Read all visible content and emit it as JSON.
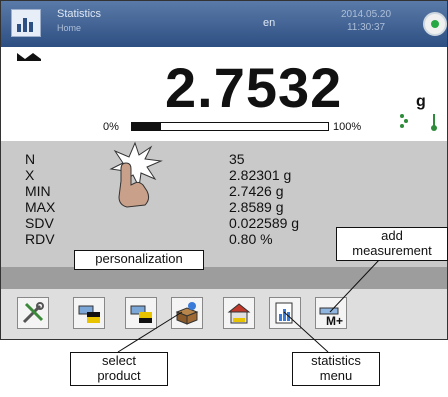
{
  "header": {
    "app_title": "Statistics",
    "app_subtitle": "Home",
    "language": "en",
    "date": "2014.05.20",
    "time": "11:30:37",
    "logo_icon": "statistics-chart-icon",
    "status_icon": "level-indicator-icon"
  },
  "weighing": {
    "reading": "2.7532",
    "unit": "g",
    "range_min_label": "0%",
    "range_max_label": "100%",
    "bar_fill_fraction": 0.15
  },
  "stats": {
    "rows": [
      {
        "label": "N",
        "value": "35"
      },
      {
        "label": "X",
        "value": "2.82301 g"
      },
      {
        "label": "MIN",
        "value": "2.7426 g"
      },
      {
        "label": "MAX",
        "value": "2.8589 g"
      },
      {
        "label": "SDV",
        "value": "0.022589 g"
      },
      {
        "label": "RDV",
        "value": "0.80 %"
      }
    ]
  },
  "toolbar": {
    "buttons": [
      {
        "icon": "settings-tools-icon"
      },
      {
        "icon": "printer-header-icon"
      },
      {
        "icon": "printer-footer-icon"
      },
      {
        "icon": "product-box-icon"
      },
      {
        "icon": "home-warehouse-icon"
      },
      {
        "icon": "statistics-menu-icon"
      },
      {
        "icon": "add-measurement-icon",
        "text": "M+"
      }
    ]
  },
  "callouts": {
    "personalization": "personalization",
    "add_measurement_line1": "add",
    "add_measurement_line2": "measurement",
    "select_product_line1": "select",
    "select_product_line2": "product",
    "statistics_menu_line1": "statistics",
    "statistics_menu_line2": "menu"
  },
  "colors": {
    "header": "#2d4f82",
    "stats_panel": "#c9c9c9",
    "toolbar": "#dedede",
    "status_green": "#27a844"
  }
}
